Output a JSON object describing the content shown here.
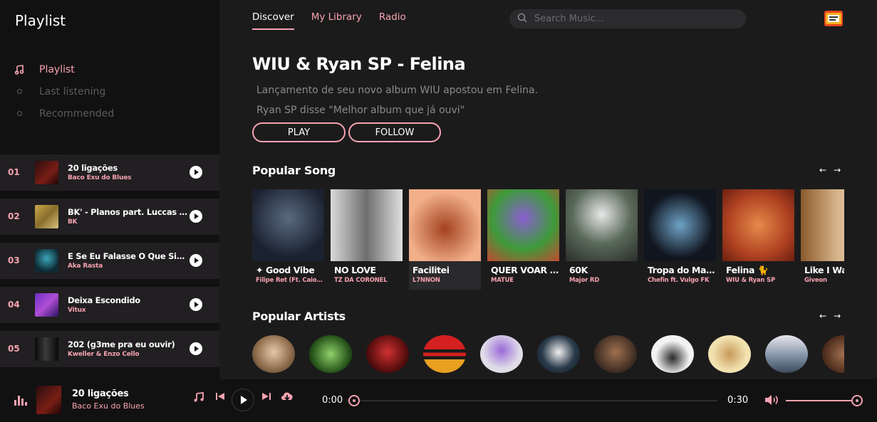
{
  "sidebar": {
    "title": "Playlist",
    "nav": [
      {
        "label": "Playlist",
        "icon": "music-note-icon"
      },
      {
        "label": "Last listening",
        "icon": "dot-icon"
      },
      {
        "label": "Recommended",
        "icon": "dot-icon"
      }
    ],
    "queue": [
      {
        "num": "01",
        "title": "20 ligações",
        "artist": "Baco Exu do Blues"
      },
      {
        "num": "02",
        "title": "BK' - Planos part. Luccas Carlos",
        "artist": "BK"
      },
      {
        "num": "03",
        "title": "E Se Eu Falasse O Que Sinto?",
        "artist": "Aka Rasta"
      },
      {
        "num": "04",
        "title": "Deixa Escondido",
        "artist": "Vitux"
      },
      {
        "num": "05",
        "title": "202 (g3me pra eu ouvir)",
        "artist": "Kweller & Enzo Cello"
      }
    ]
  },
  "header": {
    "tabs": [
      "Discover",
      "My Library",
      "Radio"
    ],
    "search_placeholder": "Search Music..."
  },
  "hero": {
    "title": "WIU & Ryan SP - Felina",
    "desc1": "Lançamento de seu novo album WIU apostou em Felina.",
    "desc2": "Ryan SP disse \"Melhor album que já ouvi\"",
    "play_label": "PLAY",
    "follow_label": "FOLLOW"
  },
  "popular_song": {
    "title": "Popular Song",
    "items": [
      {
        "title": "✦ Good Vibe",
        "artist": "Filipe Ret (Ft. Caio Luccas)"
      },
      {
        "title": "NO LOVE",
        "artist": "TZ DA CORONEL"
      },
      {
        "title": "Facilitei",
        "artist": "L7NNON"
      },
      {
        "title": "QUER VOAR 🩸",
        "artist": "MATUÊ"
      },
      {
        "title": "60K",
        "artist": "Major RD"
      },
      {
        "title": "Tropa do Maior",
        "artist": "Chefin ft. Vulgo FK"
      },
      {
        "title": "Felina 🐈",
        "artist": "WIU & Ryan SP"
      },
      {
        "title": "Like I Want",
        "artist": "Giveon"
      }
    ]
  },
  "popular_artists": {
    "title": "Popular Artists"
  },
  "player": {
    "title": "20 ligações",
    "artist": "Baco Exu do Blues",
    "current_time": "0:00",
    "end_time": "0:30",
    "progress": 0,
    "volume": 1.0
  },
  "colors": {
    "accent": "#f6a3b0",
    "background": "#1c1b1c",
    "sidebar": "#121112"
  }
}
